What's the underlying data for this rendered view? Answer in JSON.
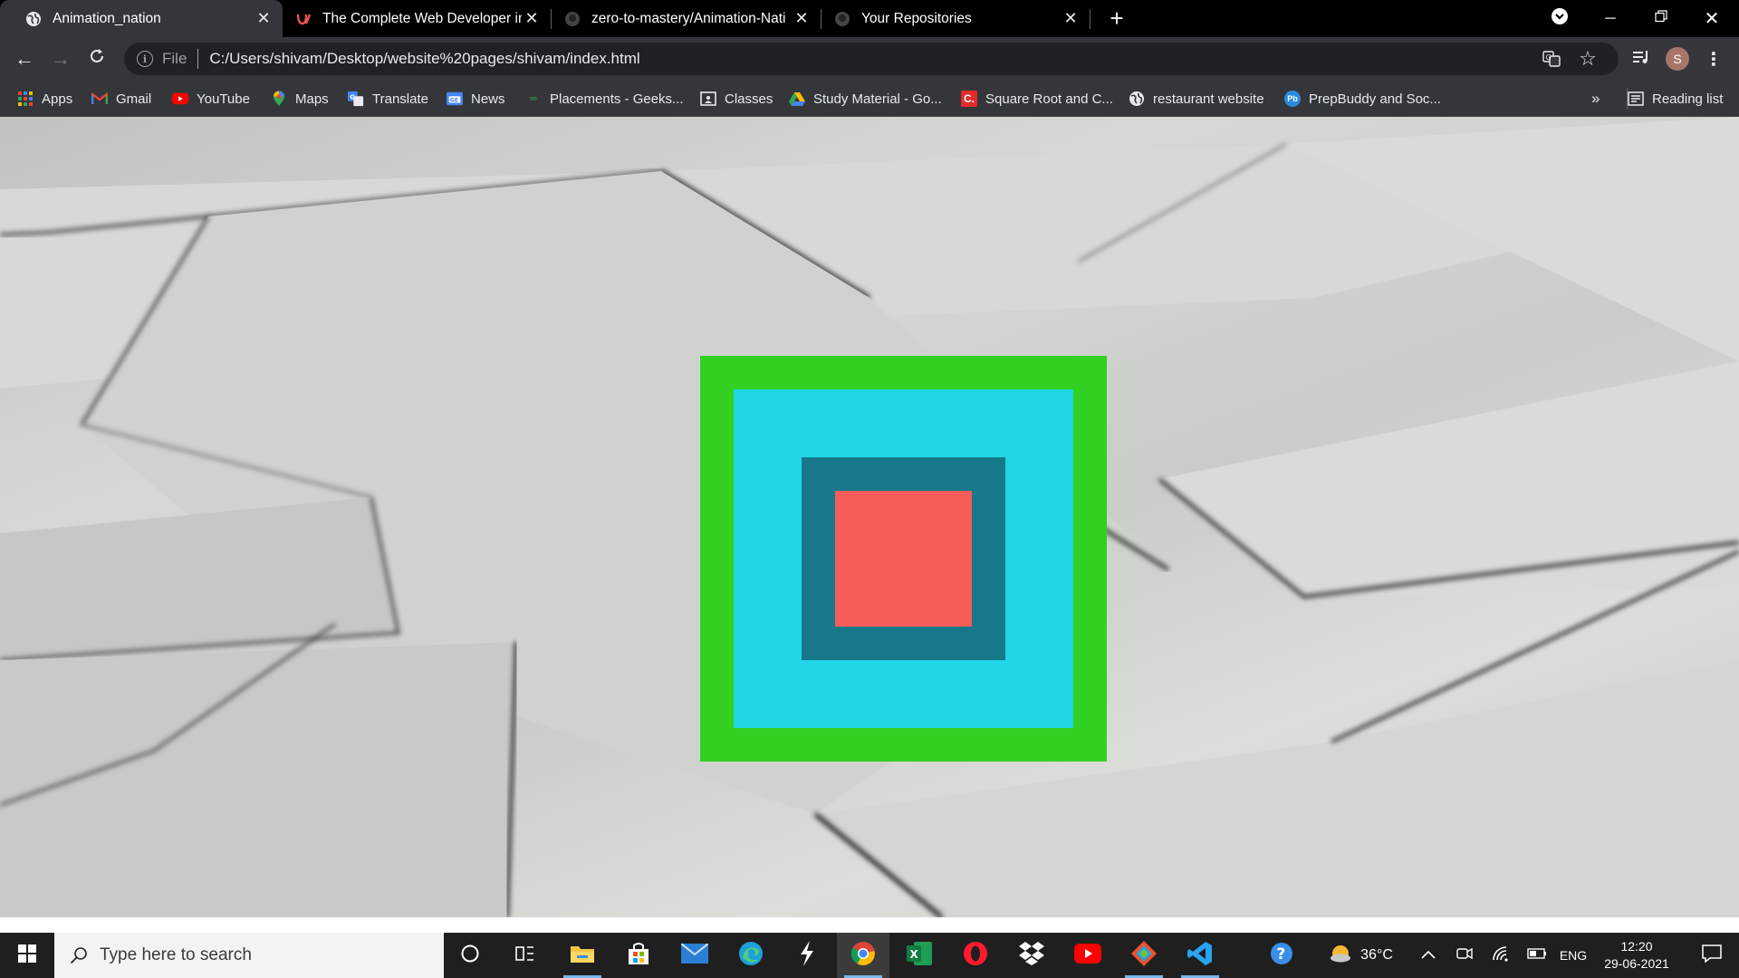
{
  "browser": {
    "tabs": [
      {
        "title": "Animation_nation",
        "active": true,
        "icon": "globe-icon"
      },
      {
        "title": "The Complete Web Developer in",
        "active": false,
        "icon": "udemy-icon"
      },
      {
        "title": "zero-to-mastery/Animation-Nati",
        "active": false,
        "icon": "github-icon"
      },
      {
        "title": "Your Repositories",
        "active": false,
        "icon": "github-icon"
      }
    ],
    "new_tab_label": "+",
    "address": {
      "scheme_label": "File",
      "url": "C:/Users/shivam/Desktop/website%20pages/shivam/index.html"
    },
    "profile_initial": "S",
    "bookmarks": [
      {
        "label": "Apps",
        "icon": "apps-grid-icon"
      },
      {
        "label": "Gmail",
        "icon": "gmail-icon"
      },
      {
        "label": "YouTube",
        "icon": "youtube-icon"
      },
      {
        "label": "Maps",
        "icon": "maps-pin-icon"
      },
      {
        "label": "Translate",
        "icon": "translate-icon"
      },
      {
        "label": "News",
        "icon": "news-icon"
      },
      {
        "label": "Placements - Geeks...",
        "icon": "geeksforgeeks-icon"
      },
      {
        "label": "Classes",
        "icon": "classroom-icon"
      },
      {
        "label": "Study Material - Go...",
        "icon": "google-drive-icon"
      },
      {
        "label": "Square Root and C...",
        "icon": "c-icon"
      },
      {
        "label": "restaurant website",
        "icon": "globe-icon"
      },
      {
        "label": "PrepBuddy and Soc...",
        "icon": "prepbuddy-icon"
      }
    ],
    "bookmarks_overflow": "»",
    "reading_list_label": "Reading list"
  },
  "page": {
    "squares": {
      "outer_color": "#32d121",
      "ring_color": "#20d6e6",
      "inner_color": "#17788a",
      "core_color": "#f65d59"
    }
  },
  "taskbar": {
    "search_placeholder": "Type here to search",
    "weather": "36°C",
    "language": "ENG",
    "time": "12:20",
    "date": "29-06-2021"
  }
}
